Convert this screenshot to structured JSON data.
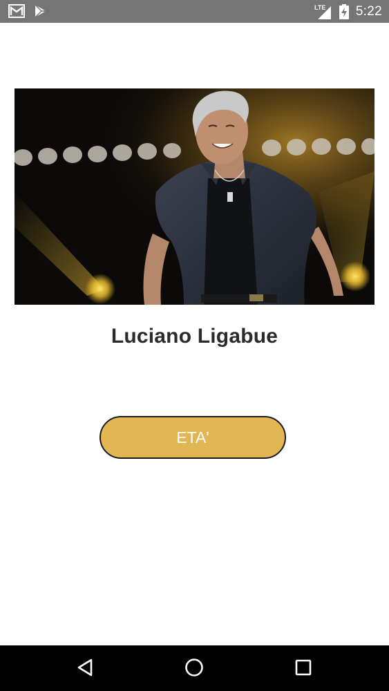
{
  "status_bar": {
    "time": "5:22",
    "network": "LTE",
    "icons": [
      "gmail-icon",
      "play-store-icon",
      "lte-signal-icon",
      "battery-charging-icon"
    ]
  },
  "main": {
    "photo_alt": "Luciano Ligabue",
    "artist_name": "Luciano Ligabue",
    "age_button_label": "ETA'"
  },
  "nav_bar": {
    "icons": [
      "back-icon",
      "home-icon",
      "recents-icon"
    ]
  },
  "colors": {
    "status_bar": "#757575",
    "button_fill": "#e2b753",
    "button_border": "#1a1a1a",
    "name_text": "#2b2b2b",
    "nav_bar": "#000000"
  }
}
